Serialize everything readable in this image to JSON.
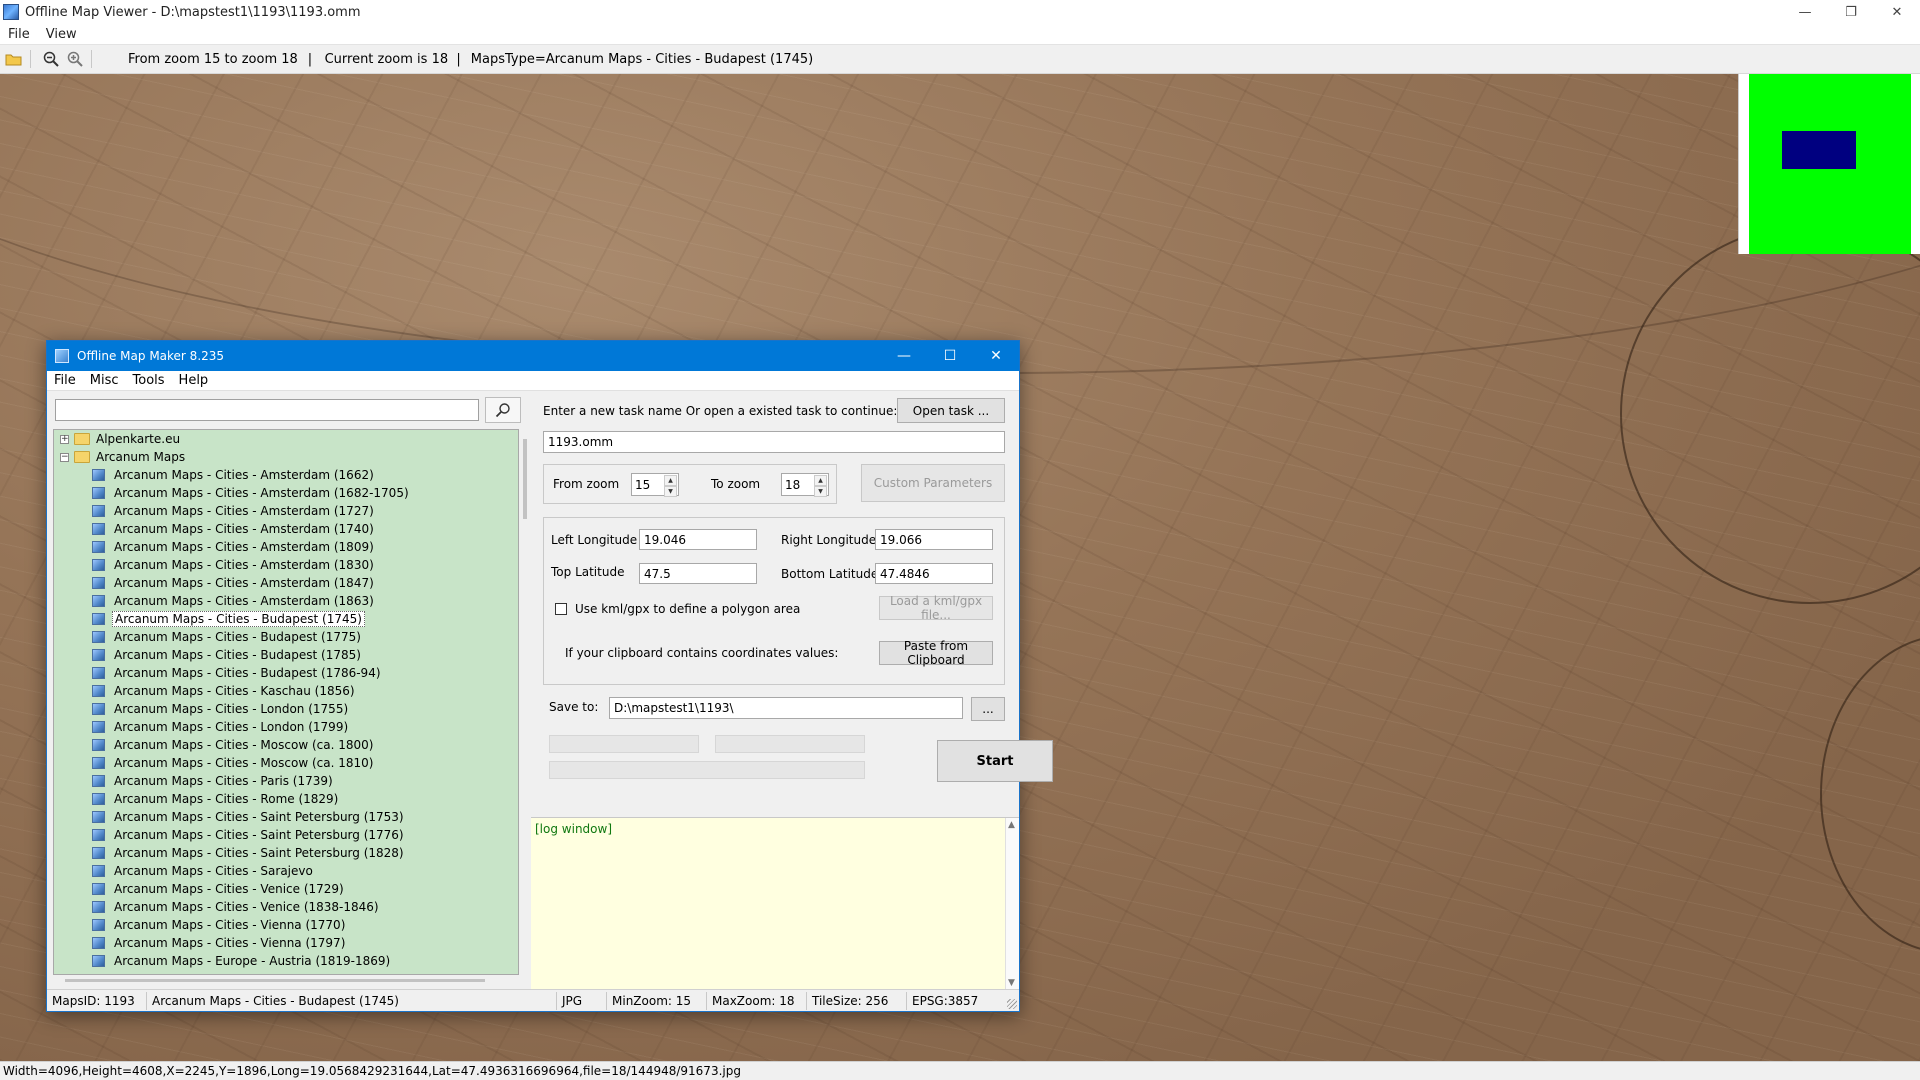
{
  "window": {
    "title": "Offline Map Viewer - D:\\mapstest1\\1193\\1193.omm",
    "minimize": "—",
    "maximize": "❐",
    "close": "✕"
  },
  "menu": {
    "file": "File",
    "view": "View"
  },
  "toolbar": {
    "zoom_range": "From zoom 15 to zoom 18",
    "current_zoom": "|   Current zoom is 18  |",
    "maps_type": "MapsType=Arcanum Maps - Cities - Budapest (1745)"
  },
  "statusbar": {
    "text": "Width=4096,Height=4608,X=2245,Y=1896,Long=19.0568429231644,Lat=47.4936316696964,file=18/144948/91673.jpg"
  },
  "colors": {
    "overview_green": "#00ff00",
    "overview_blue": "#000080",
    "dialog_title": "#0078d7",
    "tree_bg": "#c8e4c8",
    "log_bg": "#ffffe0"
  },
  "dialog": {
    "title": "Offline Map Maker 8.235",
    "minimize": "—",
    "maximize": "☐",
    "close": "✕",
    "menu": {
      "file": "File",
      "misc": "Misc",
      "tools": "Tools",
      "help": "Help"
    },
    "search": {
      "value": "",
      "placeholder": ""
    },
    "tree": {
      "root_items": [
        {
          "label": "Alpenkarte.eu",
          "expanded": false
        },
        {
          "label": "Arcanum Maps",
          "expanded": true
        }
      ],
      "children": [
        "Arcanum Maps - Cities - Amsterdam (1662)",
        "Arcanum Maps - Cities - Amsterdam (1682-1705)",
        "Arcanum Maps - Cities - Amsterdam (1727)",
        "Arcanum Maps - Cities - Amsterdam (1740)",
        "Arcanum Maps - Cities - Amsterdam (1809)",
        "Arcanum Maps - Cities - Amsterdam (1830)",
        "Arcanum Maps - Cities - Amsterdam (1847)",
        "Arcanum Maps - Cities - Amsterdam (1863)",
        "Arcanum Maps - Cities - Budapest (1745)",
        "Arcanum Maps - Cities - Budapest (1775)",
        "Arcanum Maps - Cities - Budapest (1785)",
        "Arcanum Maps - Cities - Budapest (1786-94)",
        "Arcanum Maps - Cities - Kaschau (1856)",
        "Arcanum Maps - Cities - London (1755)",
        "Arcanum Maps - Cities - London (1799)",
        "Arcanum Maps - Cities - Moscow (ca. 1800)",
        "Arcanum Maps - Cities - Moscow (ca. 1810)",
        "Arcanum Maps - Cities - Paris (1739)",
        "Arcanum Maps - Cities - Rome (1829)",
        "Arcanum Maps - Cities - Saint Petersburg (1753)",
        "Arcanum Maps - Cities - Saint Petersburg (1776)",
        "Arcanum Maps - Cities - Saint Petersburg (1828)",
        "Arcanum Maps - Cities - Sarajevo",
        "Arcanum Maps - Cities - Venice (1729)",
        "Arcanum Maps - Cities - Venice (1838-1846)",
        "Arcanum Maps - Cities - Vienna (1770)",
        "Arcanum Maps - Cities - Vienna (1797)",
        "Arcanum Maps - Europe - Austria (1819-1869)"
      ],
      "selected_index": 8
    },
    "task_prompt": "Enter a new task name Or open a existed task to continue:",
    "open_task": "Open task ...",
    "task_name": "1193.omm",
    "from_zoom_label": "From zoom",
    "from_zoom": "15",
    "to_zoom_label": "To zoom",
    "to_zoom": "18",
    "custom_params": "Custom Parameters",
    "left_lon_label": "Left Longitude",
    "left_lon": "19.046",
    "right_lon_label": "Right Longitude",
    "right_lon": "19.066",
    "top_lat_label": "Top Latitude",
    "top_lat": "47.5",
    "bottom_lat_label": "Bottom Latitude",
    "bottom_lat": "47.4846",
    "kml_label": "Use kml/gpx to define a polygon area",
    "load_kml": "Load a kml/gpx file...",
    "clipboard_label": "If your clipboard contains coordinates values:",
    "paste_clipboard": "Paste from Clipboard",
    "save_to_label": "Save to:",
    "save_to": "D:\\mapstest1\\1193\\",
    "browse": "...",
    "start": "Start",
    "log": "[log window]",
    "status": {
      "maps_id": "MapsID: 1193",
      "map_name": "Arcanum Maps - Cities - Budapest (1745)",
      "format": "JPG",
      "min_zoom": "MinZoom: 15",
      "max_zoom": "MaxZoom: 18",
      "tile_size": "TileSize: 256",
      "epsg": "EPSG:3857"
    }
  }
}
